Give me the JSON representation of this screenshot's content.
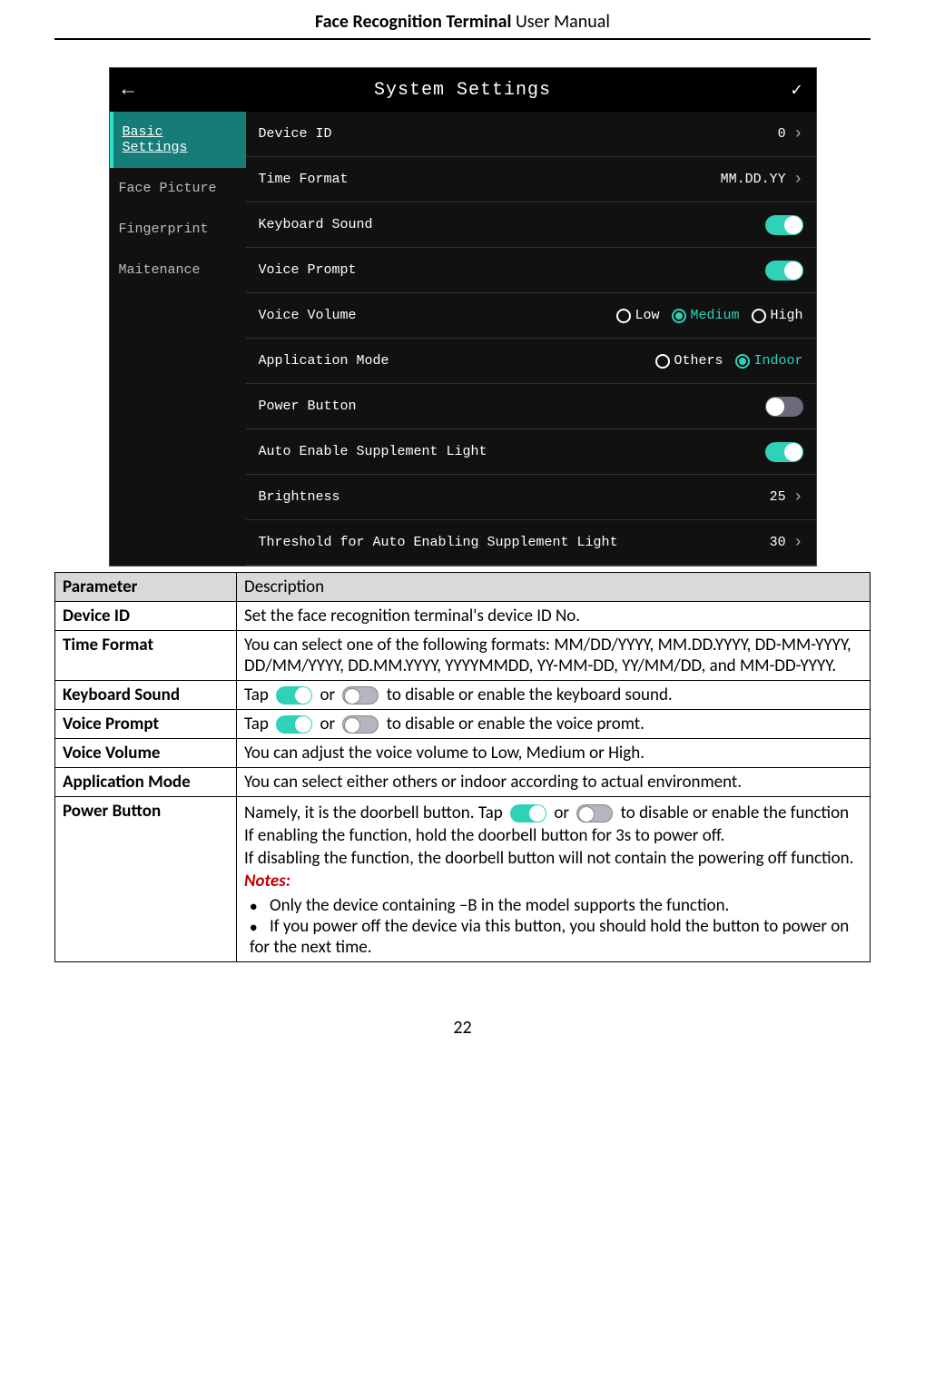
{
  "doc": {
    "title_bold": "Face Recognition Terminal",
    "title_norm": "  User Manual",
    "page_number": "22"
  },
  "screenshot": {
    "header_title": "System Settings",
    "sidebar": [
      {
        "label": "Basic Settings",
        "active": true
      },
      {
        "label": "Face Picture",
        "active": false
      },
      {
        "label": "Fingerprint",
        "active": false
      },
      {
        "label": "Maitenance",
        "active": false
      }
    ],
    "rows": {
      "device_id": {
        "label": "Device ID",
        "value": "0"
      },
      "time_format": {
        "label": "Time Format",
        "value": "MM.DD.YY"
      },
      "keyboard_sound": {
        "label": "Keyboard Sound",
        "toggle": true
      },
      "voice_prompt": {
        "label": "Voice Prompt",
        "toggle": true
      },
      "voice_volume": {
        "label": "Voice Volume",
        "options": [
          {
            "text": "Low",
            "selected": false
          },
          {
            "text": "Medium",
            "selected": true
          },
          {
            "text": "High",
            "selected": false
          }
        ]
      },
      "app_mode": {
        "label": "Application Mode",
        "options": [
          {
            "text": "Others",
            "selected": false
          },
          {
            "text": "Indoor",
            "selected": true
          }
        ]
      },
      "power_button": {
        "label": "Power Button",
        "toggle": false
      },
      "auto_supp": {
        "label": "Auto Enable Supplement Light",
        "toggle": true
      },
      "brightness": {
        "label": "Brightness",
        "value": "25"
      },
      "threshold": {
        "label": "Threshold for Auto Enabling Supplement Light",
        "value": "30"
      }
    }
  },
  "table": {
    "head_param": "Parameter",
    "head_desc": "Description",
    "rows": {
      "device_id": {
        "param": "Device ID",
        "desc": "Set the face recognition terminal's device ID No."
      },
      "time_format": {
        "param": "Time Format",
        "desc": "You can select one of the following formats: MM/DD/YYYY, MM.DD.YYYY, DD-MM-YYYY, DD/MM/YYYY, DD.MM.YYYY, YYYYMMDD, YY-MM-DD, YY/MM/DD, and MM-DD-YYYY."
      },
      "keyboard_sound": {
        "param": "Keyboard Sound",
        "pre": "Tap ",
        "mid": " or ",
        "post": " to disable or enable the keyboard sound."
      },
      "voice_prompt": {
        "param": "Voice Prompt",
        "pre": "Tap ",
        "mid": " or ",
        "post": " to disable or enable the voice promt."
      },
      "voice_volume": {
        "param": "Voice Volume",
        "desc": "You can adjust the voice volume to Low, Medium or High."
      },
      "app_mode": {
        "param": "Application Mode",
        "desc": "You can select either others or indoor according to actual environment."
      },
      "power_button": {
        "param": "Power Button",
        "l1_pre": "Namely, it is the doorbell button. Tap ",
        "l1_mid": " or ",
        "l1_post": " to disable or enable the function",
        "l2": "If enabling the function, hold the doorbell button for 3s to power off.",
        "l3": "If disabling the function, the doorbell button will not contain the powering off function.",
        "notes_label": "Notes:",
        "note1": "Only the device containing –B in the model supports the function.",
        "note2": "If you power off the device via this button, you should hold the button to power on for the next time."
      }
    }
  }
}
